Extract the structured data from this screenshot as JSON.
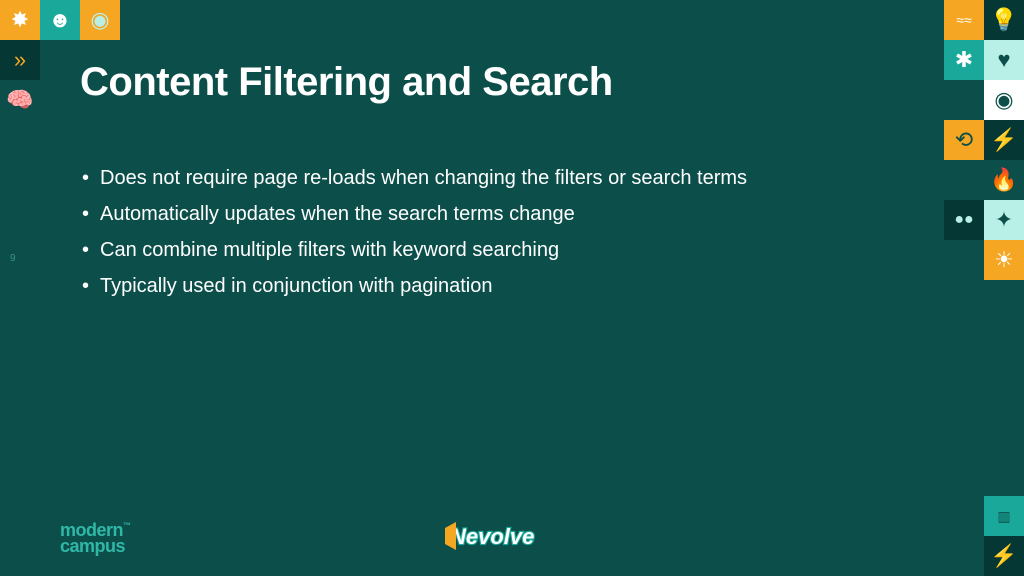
{
  "slide": {
    "title": "Content Filtering and Search",
    "bullets": [
      "Does not require page re-loads when changing the filters or search terms",
      "Automatically updates when the search terms change",
      "Can combine multiple filters with keyword searching",
      "Typically used in conjunction with pagination"
    ],
    "page_number": "9"
  },
  "branding": {
    "left_logo_line1": "modern",
    "left_logo_line2": "campus",
    "left_logo_tm": "™",
    "center_logo_text": "evolve"
  },
  "colors": {
    "bg": "#0c4f4a",
    "accent_gold": "#f5a623",
    "accent_teal": "#1aa89a",
    "accent_mint": "#b8f0e8"
  }
}
